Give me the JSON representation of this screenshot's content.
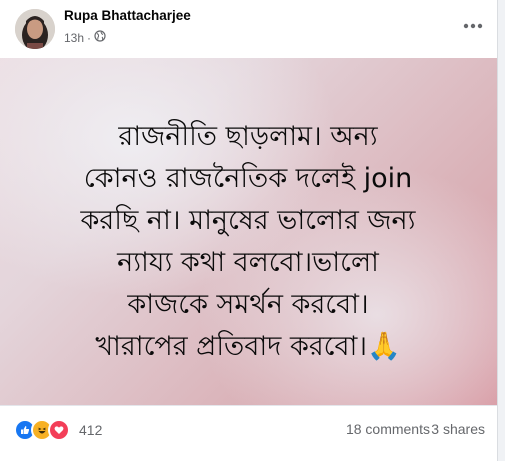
{
  "post": {
    "author": "Rupa Bhattacharjee",
    "time": "13h",
    "separator": "·",
    "audience_icon": "globe-icon",
    "more_icon": "more-options-icon",
    "image_lines": [
      "রাজনীতি ছাড়লাম। অন্য",
      "কোনও রাজনৈতিক দলেই join",
      "করছি না। মানুষের ভালোর জন্য",
      "ন্যায্য কথা বলবো।ভালো",
      "কাজকে সমর্থন করবো।",
      "খারাপের প্রতিবাদ করবো।🙏"
    ]
  },
  "stats": {
    "reaction_icons": [
      "like-icon",
      "haha-icon",
      "love-icon"
    ],
    "reaction_count": "412",
    "comments": "18 comments",
    "shares": "3 shares"
  },
  "colors": {
    "like": "#1877f2",
    "love": "#f33e58",
    "haha": "#f7b125"
  }
}
